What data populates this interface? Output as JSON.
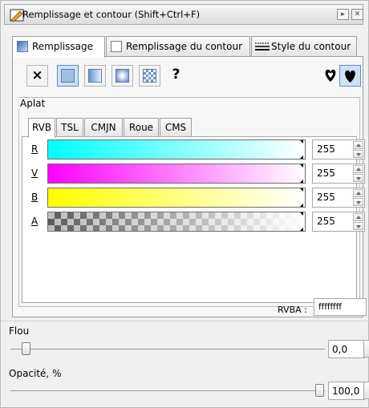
{
  "window": {
    "title": "Remplissage et contour (Shift+Ctrl+F)"
  },
  "tabs": [
    {
      "label": "Remplissage",
      "active": true
    },
    {
      "label": "Remplissage du contour",
      "active": false
    },
    {
      "label": "Style du contour",
      "active": false
    }
  ],
  "paint_types": [
    {
      "name": "no-paint",
      "glyph": "×"
    },
    {
      "name": "flat-color",
      "selected": true
    },
    {
      "name": "linear-gradient"
    },
    {
      "name": "radial-gradient"
    },
    {
      "name": "pattern"
    },
    {
      "name": "unset",
      "glyph": "?"
    }
  ],
  "fill_rule": {
    "evenodd_icon": "evenodd-icon",
    "nonzero_icon": "nonzero-icon"
  },
  "aplat": {
    "legend": "Aplat",
    "color_tabs": [
      "RVB",
      "TSL",
      "CMJN",
      "Roue",
      "CMS"
    ],
    "active_tab": "RVB",
    "channels": [
      {
        "label": "R",
        "value": "255",
        "from": "#00ffff",
        "to": "#ffffff"
      },
      {
        "label": "V",
        "value": "255",
        "from": "#ff00ff",
        "to": "#ffffff"
      },
      {
        "label": "B",
        "value": "255",
        "from": "#ffff00",
        "to": "#ffffff"
      },
      {
        "label": "A",
        "value": "255",
        "from": "checker",
        "to": "#ffffff"
      }
    ],
    "rgba_label": "RVBA :",
    "rgba_value": "ffffffff"
  },
  "blur": {
    "label": "Flou",
    "value": "0,0",
    "level": 0.0
  },
  "opacity": {
    "label": "Opacité, %",
    "value": "100,0",
    "level": 1.0
  },
  "colors": {
    "accent": "#cfe2f8",
    "panel": "#f0f0f0"
  }
}
